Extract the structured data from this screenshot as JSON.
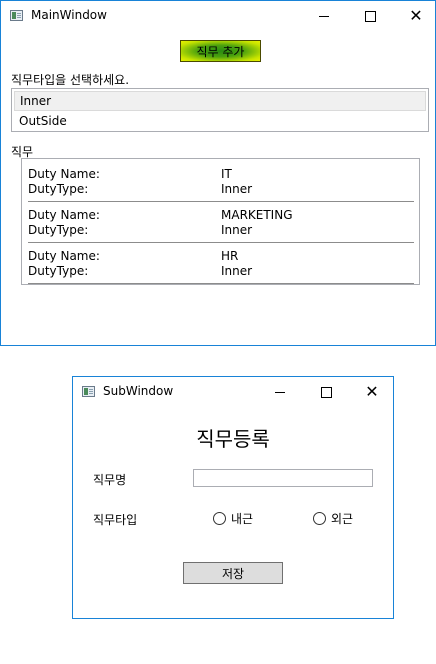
{
  "main_window": {
    "title": "MainWindow",
    "add_button_label": "직무 추가",
    "type_prompt": "직무타입을 선택하세요.",
    "type_options": [
      "Inner",
      "OutSide"
    ],
    "selected_type": "Inner",
    "duty_section_label": "직무",
    "duties": [
      {
        "name_key": "Duty Name:",
        "name": "IT",
        "type_key": "DutyType:",
        "type": "Inner"
      },
      {
        "name_key": "Duty Name:",
        "name": "MARKETING",
        "type_key": "DutyType:",
        "type": "Inner"
      },
      {
        "name_key": "Duty Name:",
        "name": "HR",
        "type_key": "DutyType:",
        "type": "Inner"
      }
    ]
  },
  "sub_window": {
    "title": "SubWindow",
    "heading": "직무등록",
    "name_label": "직무명",
    "name_value": "",
    "type_label": "직무타입",
    "radio_options": [
      "내근",
      "외근"
    ],
    "save_label": "저장"
  },
  "colors": {
    "window_border": "#1883d7",
    "add_button_gradient": [
      "#2a8c12",
      "#e8f200"
    ]
  },
  "icons": {
    "window_icon": "app-window-icon",
    "minimize": "minimize-icon",
    "maximize": "maximize-icon",
    "close": "close-icon",
    "radio": "radio-unchecked-icon"
  }
}
